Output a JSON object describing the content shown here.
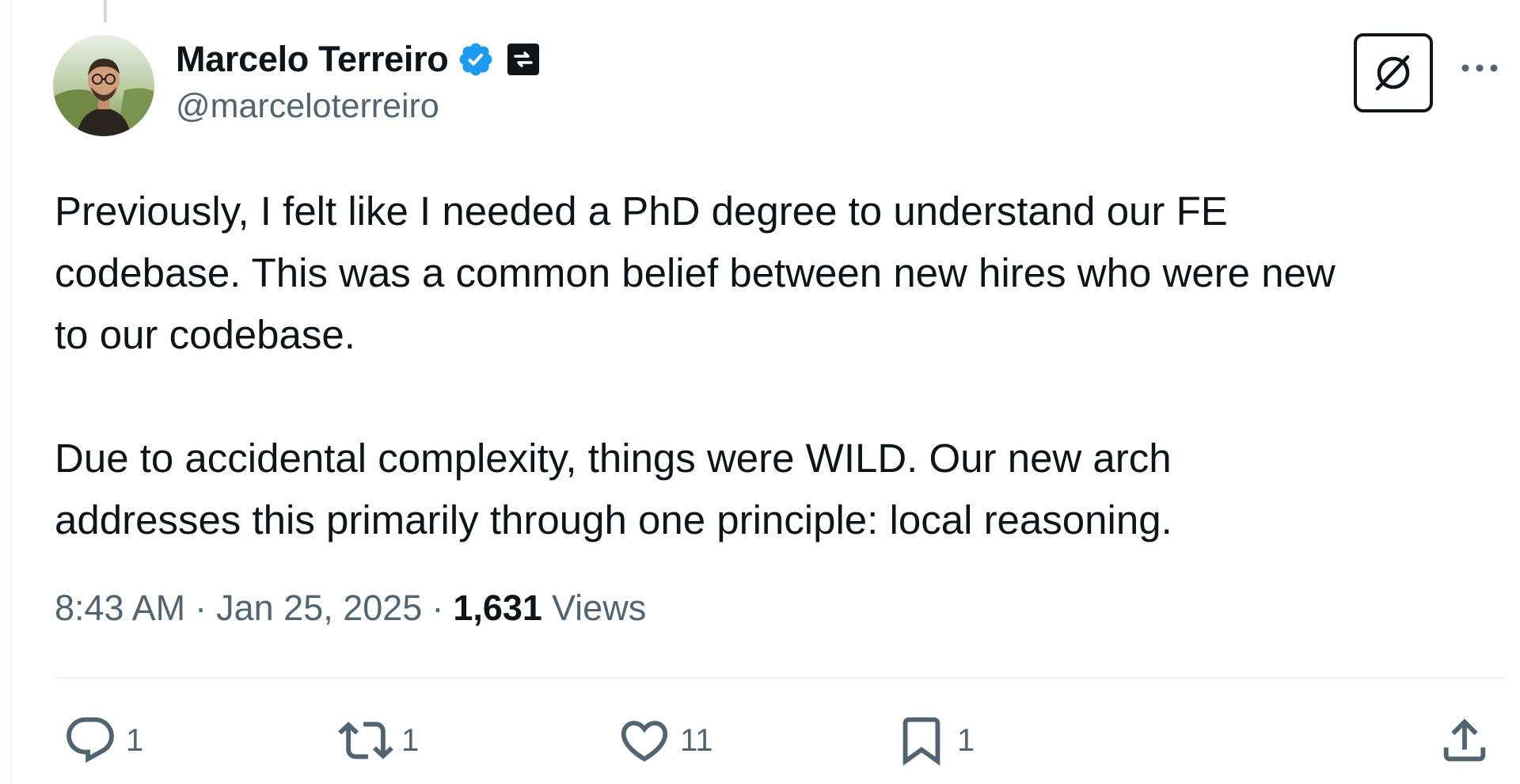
{
  "author": {
    "display_name": "Marcelo Terreiro",
    "handle": "@marceloterreiro"
  },
  "tweet": {
    "text": "Previously, I felt like I needed a PhD degree to understand our FE\ncodebase. This was a common belief between new hires who were new\nto our codebase.\n\nDue to accidental complexity, things were WILD. Our new arch\naddresses this primarily through one principle: local reasoning."
  },
  "meta": {
    "time": "8:43 AM",
    "separator": "·",
    "date": "Jan 25, 2025",
    "views_count": "1,631",
    "views_label": "Views"
  },
  "actions": {
    "replies": "1",
    "reposts": "1",
    "likes": "11",
    "bookmarks": "1"
  },
  "icons": {
    "verified": "verified-badge-icon",
    "affiliate": "affiliate-badge-icon",
    "grok": "grok-icon",
    "more": "more-icon",
    "reply": "reply-icon",
    "repost": "repost-icon",
    "like": "heart-icon",
    "bookmark": "bookmark-icon",
    "share": "share-icon"
  },
  "colors": {
    "text": "#0f1419",
    "secondary": "#536471",
    "verified": "#1d9bf0",
    "divider": "#eff3f4"
  }
}
